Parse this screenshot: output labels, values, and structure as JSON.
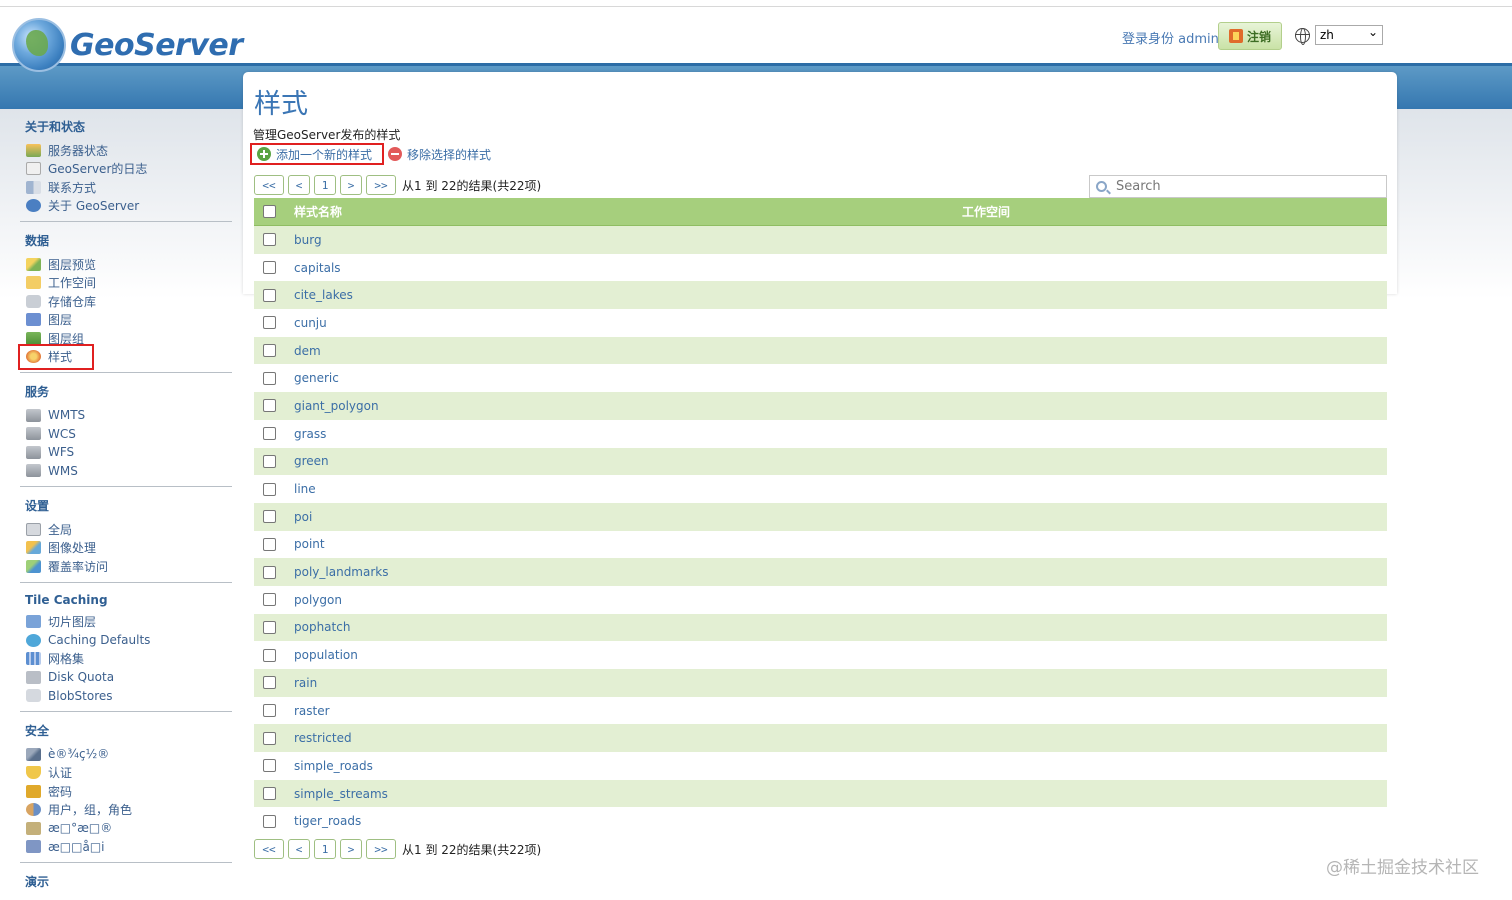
{
  "app": {
    "logo_text": "GeoServer"
  },
  "header": {
    "login_text": "登录身份 admin.",
    "logout_label": "注销",
    "language": "zh"
  },
  "sidebar": {
    "sections": [
      {
        "title": "关于和状态",
        "items": [
          "服务器状态",
          "GeoServer的日志",
          "联系方式",
          "关于 GeoServer"
        ]
      },
      {
        "title": "数据",
        "items": [
          "图层预览",
          "工作空间",
          "存储仓库",
          "图层",
          "图层组",
          "样式"
        ]
      },
      {
        "title": "服务",
        "items": [
          "WMTS",
          "WCS",
          "WFS",
          "WMS"
        ]
      },
      {
        "title": "设置",
        "items": [
          "全局",
          "图像处理",
          "覆盖率访问"
        ]
      },
      {
        "title": "Tile Caching",
        "items": [
          "切片图层",
          "Caching Defaults",
          "网格集",
          "Disk Quota",
          "BlobStores"
        ]
      },
      {
        "title": "安全",
        "items": [
          "è®¾ç½®",
          "认证",
          "密码",
          "用户，组，角色",
          "æ□°æ□®",
          "æ□□å□i"
        ]
      },
      {
        "title": "演示",
        "items": []
      }
    ]
  },
  "main": {
    "title": "样式",
    "description": "管理GeoServer发布的样式",
    "add_label": "添加一个新的样式",
    "remove_label": "移除选择的样式",
    "pager": {
      "first": "<<",
      "prev": "<",
      "page": "1",
      "next": ">",
      "last": ">>",
      "info": "从1 到 22的结果(共22项)"
    },
    "search_placeholder": "Search",
    "columns": {
      "name": "样式名称",
      "workspace": "工作空间"
    },
    "rows": [
      "burg",
      "capitals",
      "cite_lakes",
      "cunju",
      "dem",
      "generic",
      "giant_polygon",
      "grass",
      "green",
      "line",
      "poi",
      "point",
      "poly_landmarks",
      "polygon",
      "pophatch",
      "population",
      "rain",
      "raster",
      "restricted",
      "simple_roads",
      "simple_streams",
      "tiger_roads"
    ]
  },
  "watermark": "@稀土掘金技术社区"
}
